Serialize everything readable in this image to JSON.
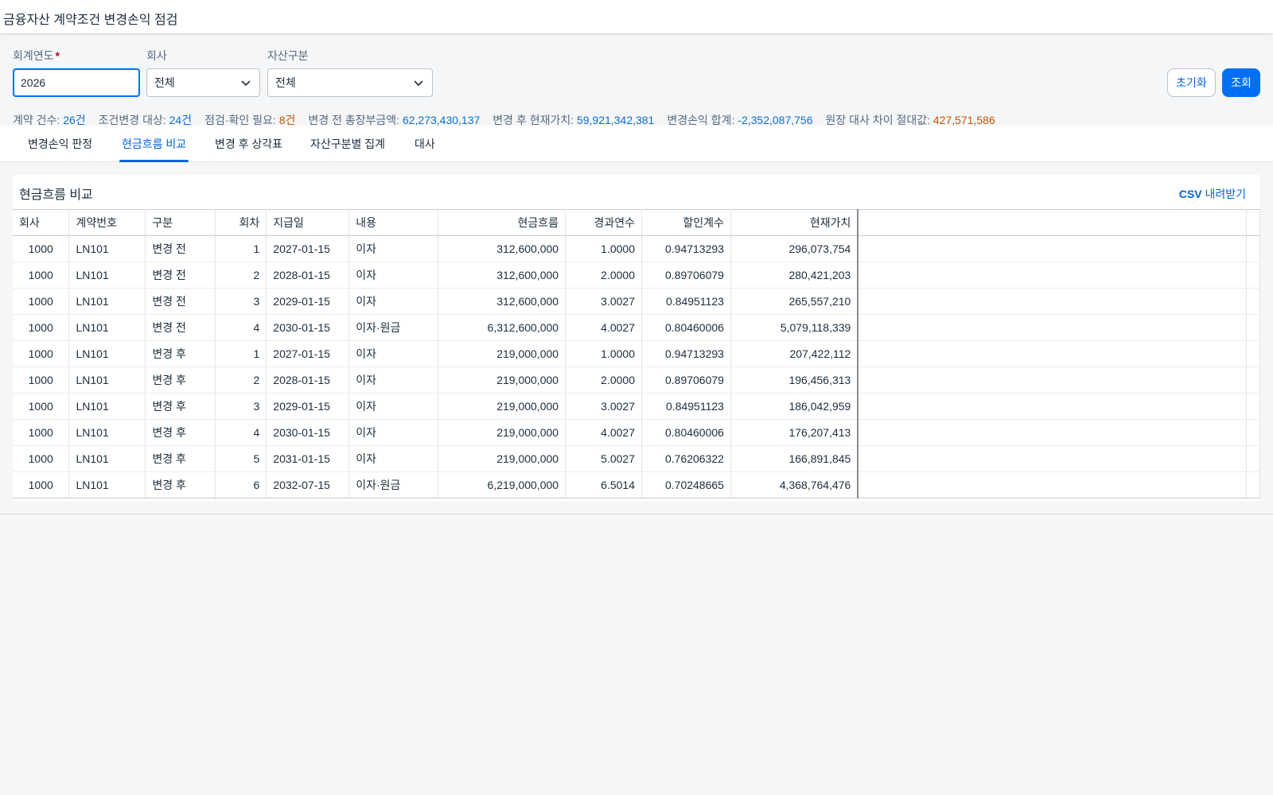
{
  "app": {
    "title": "금융자산 계약조건 변경손익 점검"
  },
  "filters": {
    "year": {
      "label": "회계연도",
      "required_mark": "*",
      "value": "2026"
    },
    "company": {
      "label": "회사",
      "value": "전체"
    },
    "asset_type": {
      "label": "자산구분",
      "value": "전체"
    },
    "reset_label": "초기화",
    "search_label": "조회"
  },
  "summary": [
    {
      "label": "계약 건수:",
      "value": "26건",
      "color": "blue"
    },
    {
      "label": "조건변경 대상:",
      "value": "24건",
      "color": "blue"
    },
    {
      "label": "점검·확인 필요:",
      "value": "8건",
      "color": "orange"
    },
    {
      "label": "변경 전 총장부금액:",
      "value": "62,273,430,137",
      "color": "blue"
    },
    {
      "label": "변경 후 현재가치:",
      "value": "59,921,342,381",
      "color": "blue"
    },
    {
      "label": "변경손익 합계:",
      "value": "-2,352,087,756",
      "color": "blue"
    },
    {
      "label": "원장 대사 차이 절대값:",
      "value": "427,571,586",
      "color": "orange"
    }
  ],
  "tabs": [
    {
      "label": "변경손익 판정",
      "active": false
    },
    {
      "label": "현금흐름 비교",
      "active": true
    },
    {
      "label": "변경 후 상각표",
      "active": false
    },
    {
      "label": "자산구분별 집계",
      "active": false
    },
    {
      "label": "대사",
      "active": false
    }
  ],
  "panel": {
    "title": "현금흐름 비교",
    "csv_bold": "CSV",
    "csv_rest": " 내려받기"
  },
  "table": {
    "columns": [
      "회사",
      "계약번호",
      "구분",
      "회차",
      "지급일",
      "내용",
      "현금흐름",
      "경과연수",
      "할인계수",
      "현재가치"
    ],
    "rows": [
      [
        "1000",
        "LN101",
        "변경 전",
        "1",
        "2027-01-15",
        "이자",
        "312,600,000",
        "1.0000",
        "0.94713293",
        "296,073,754"
      ],
      [
        "1000",
        "LN101",
        "변경 전",
        "2",
        "2028-01-15",
        "이자",
        "312,600,000",
        "2.0000",
        "0.89706079",
        "280,421,203"
      ],
      [
        "1000",
        "LN101",
        "변경 전",
        "3",
        "2029-01-15",
        "이자",
        "312,600,000",
        "3.0027",
        "0.84951123",
        "265,557,210"
      ],
      [
        "1000",
        "LN101",
        "변경 전",
        "4",
        "2030-01-15",
        "이자·원금",
        "6,312,600,000",
        "4.0027",
        "0.80460006",
        "5,079,118,339"
      ],
      [
        "1000",
        "LN101",
        "변경 후",
        "1",
        "2027-01-15",
        "이자",
        "219,000,000",
        "1.0000",
        "0.94713293",
        "207,422,112"
      ],
      [
        "1000",
        "LN101",
        "변경 후",
        "2",
        "2028-01-15",
        "이자",
        "219,000,000",
        "2.0000",
        "0.89706079",
        "196,456,313"
      ],
      [
        "1000",
        "LN101",
        "변경 후",
        "3",
        "2029-01-15",
        "이자",
        "219,000,000",
        "3.0027",
        "0.84951123",
        "186,042,959"
      ],
      [
        "1000",
        "LN101",
        "변경 후",
        "4",
        "2030-01-15",
        "이자",
        "219,000,000",
        "4.0027",
        "0.80460006",
        "176,207,413"
      ],
      [
        "1000",
        "LN101",
        "변경 후",
        "5",
        "2031-01-15",
        "이자",
        "219,000,000",
        "5.0027",
        "0.76206322",
        "166,891,845"
      ],
      [
        "1000",
        "LN101",
        "변경 후",
        "6",
        "2032-07-15",
        "이자·원금",
        "6,219,000,000",
        "6.5014",
        "0.70248665",
        "4,368,764,476"
      ]
    ]
  },
  "colors": {
    "accent": "#0070f2",
    "link": "#0064d9",
    "value_blue": "#0a6ed1",
    "value_orange": "#c35500"
  }
}
